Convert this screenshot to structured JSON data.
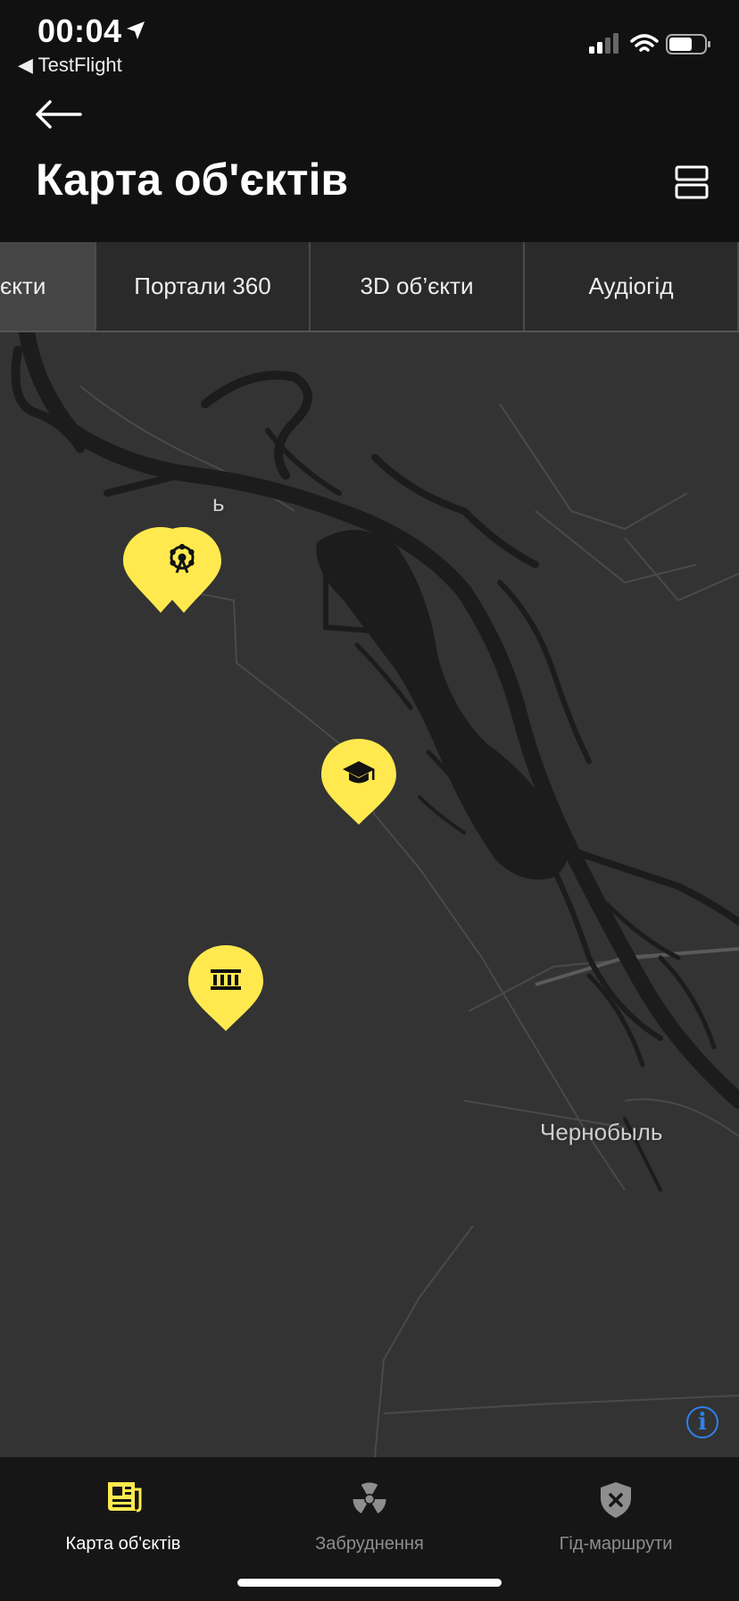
{
  "status_bar": {
    "time": "00:04",
    "back_app": "◀ TestFlight"
  },
  "header": {
    "title": "Карта об'єктів"
  },
  "tabs": [
    {
      "label": "єкти",
      "active": true
    },
    {
      "label": "Портали 360",
      "active": false
    },
    {
      "label": "3D об’єкти",
      "active": false
    },
    {
      "label": "Аудіогід",
      "active": false
    }
  ],
  "map": {
    "city_label": "Чернобыль",
    "partial_label": "ь",
    "markers": [
      {
        "icon": "ferris-wheel-icon"
      },
      {
        "icon": "graduation-cap-icon"
      },
      {
        "icon": "museum-icon"
      }
    ],
    "marker_color": "#ffe94f",
    "info_icon": "info-icon"
  },
  "bottom_nav": {
    "items": [
      {
        "label": "Карта об'єктів",
        "icon": "newspaper-icon",
        "active": true
      },
      {
        "label": "Забруднення",
        "icon": "radiation-icon",
        "active": false
      },
      {
        "label": "Гід-маршрути",
        "icon": "shield-x-icon",
        "active": false
      }
    ],
    "active_color": "#ffe94f",
    "inactive_color": "#8e8e8e"
  }
}
